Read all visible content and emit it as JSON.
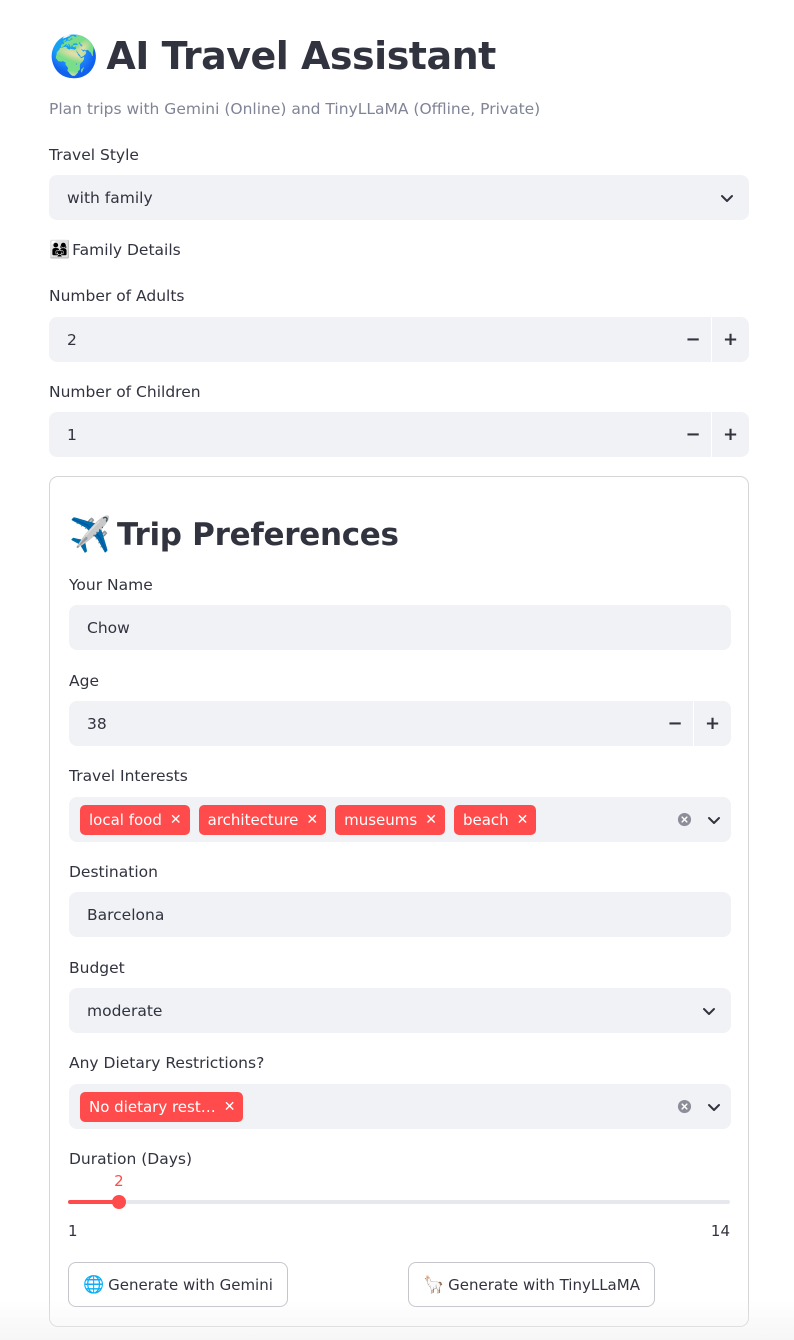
{
  "app": {
    "title_emoji": "🌍",
    "title": "AI Travel Assistant",
    "subtitle": "Plan trips with Gemini (Online) and TinyLLaMA (Offline, Private)"
  },
  "travel_style": {
    "label": "Travel Style",
    "value": "with family"
  },
  "family": {
    "header_icon": "👨‍👩‍👧",
    "header": "Family Details",
    "adults_label": "Number of Adults",
    "adults_value": "2",
    "children_label": "Number of Children",
    "children_value": "1"
  },
  "stepper": {
    "minus": "−",
    "plus": "+"
  },
  "form": {
    "title_emoji": "✈️",
    "title": "Trip Preferences",
    "name_label": "Your Name",
    "name_value": "Chow",
    "age_label": "Age",
    "age_value": "38",
    "interests_label": "Travel Interests",
    "interests": [
      "local food",
      "architecture",
      "museums",
      "beach"
    ],
    "destination_label": "Destination",
    "destination_value": "Barcelona",
    "budget_label": "Budget",
    "budget_value": "moderate",
    "dietary_label": "Any Dietary Restrictions?",
    "dietary": [
      "No dietary rest…"
    ],
    "duration_label": "Duration (Days)",
    "duration_value": 2,
    "duration_min": 1,
    "duration_max": 14,
    "gemini_icon": "🌐",
    "gemini_button": "Generate with Gemini",
    "tinyllama_icon": "🦙",
    "tinyllama_button": "Generate with TinyLLaMA"
  },
  "colors": {
    "accent": "#ff4b4b",
    "input_bg": "#f0f2f6",
    "text": "#31333f",
    "muted": "#808495"
  }
}
